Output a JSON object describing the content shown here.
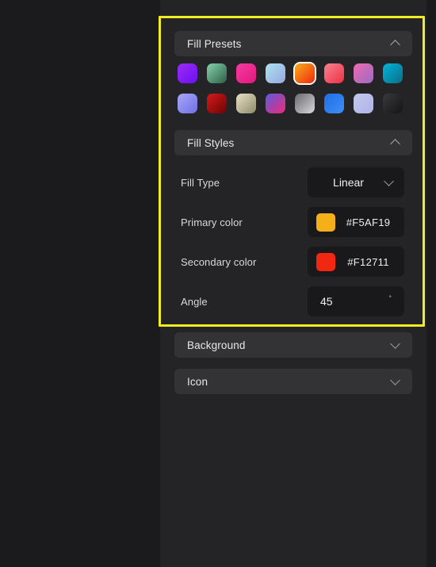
{
  "colors": {
    "canvas_bg": "#1b1b1d",
    "panel_bg": "#242426",
    "section_header_bg": "#333336",
    "field_bg": "#19191b",
    "highlight_border": "#f2ed21",
    "text_primary": "#e8e8ea",
    "text_secondary": "#d9d9dc"
  },
  "panel": {
    "sections": [
      {
        "id": "fill-presets",
        "label": "Fill Presets",
        "expanded": true,
        "chevron": "chevron-up-icon"
      },
      {
        "id": "fill-styles",
        "label": "Fill Styles",
        "expanded": true,
        "chevron": "chevron-up-icon"
      },
      {
        "id": "background",
        "label": "Background",
        "expanded": false,
        "chevron": "chevron-down-icon"
      },
      {
        "id": "icon",
        "label": "Icon",
        "expanded": false,
        "chevron": "chevron-down-icon"
      }
    ]
  },
  "fill_presets": {
    "selected_index": 4,
    "swatches": [
      {
        "name": "preset-violet",
        "gradient": "linear-gradient(135deg, #9d2bf5 0%, #6a11f0 100%)",
        "selected": false
      },
      {
        "name": "preset-green-mint",
        "gradient": "linear-gradient(135deg, #86d3ab 0%, #2c5f46 100%)",
        "selected": false
      },
      {
        "name": "preset-pink-magenta",
        "gradient": "linear-gradient(135deg, #f83a9e 0%, #e0197f 100%)",
        "selected": false
      },
      {
        "name": "preset-sky-lilac",
        "gradient": "linear-gradient(135deg, #a9e3f0 0%, #9aa7e0 100%)",
        "selected": false
      },
      {
        "name": "preset-orange-red",
        "gradient": "linear-gradient(135deg, #f5af19 0%, #f12711 100%)",
        "selected": true
      },
      {
        "name": "preset-coral-red",
        "gradient": "linear-gradient(135deg, #f7838e 0%, #ef3046 100%)",
        "selected": false
      },
      {
        "name": "preset-pink-purple",
        "gradient": "linear-gradient(135deg, #f06ab0 0%, #9b6bc4 100%)",
        "selected": false
      },
      {
        "name": "preset-cyan-teal",
        "gradient": "linear-gradient(135deg, #00b4d8 0%, #0b6e8a 100%)",
        "selected": false
      },
      {
        "name": "preset-periwinkle",
        "gradient": "linear-gradient(135deg, #a8a8f5 0%, #6f6fe8 100%)",
        "selected": false
      },
      {
        "name": "preset-crimson-dark",
        "gradient": "linear-gradient(135deg, #d61a1a 0%, #6b0404 100%)",
        "selected": false
      },
      {
        "name": "preset-sand-khaki",
        "gradient": "linear-gradient(135deg, #e8e2c4 0%, #8d8a6b 100%)",
        "selected": false
      },
      {
        "name": "preset-blue-pink",
        "gradient": "linear-gradient(135deg, #5b5bdc 0%, #f0297a 100%)",
        "selected": false
      },
      {
        "name": "preset-grey-silver",
        "gradient": "linear-gradient(135deg, #6a6a6e 0%, #d8d8dc 100%)",
        "selected": false
      },
      {
        "name": "preset-azure-blue",
        "gradient": "linear-gradient(135deg, #1e6ee8 0%, #3f8ef5 100%)",
        "selected": false
      },
      {
        "name": "preset-pale-lavender",
        "gradient": "linear-gradient(135deg, #c3c8ee 0%, #aeb5e6 100%)",
        "selected": false
      },
      {
        "name": "preset-charcoal",
        "gradient": "linear-gradient(135deg, #3a3a3c 0%, #141416 100%)",
        "selected": false
      }
    ]
  },
  "fill_styles": {
    "fill_type": {
      "label": "Fill Type",
      "value": "Linear",
      "chevron": "chevron-down-icon"
    },
    "primary_color": {
      "label": "Primary color",
      "hex": "#F5AF19",
      "swatch": "#F5AF19"
    },
    "secondary_color": {
      "label": "Secondary color",
      "hex": "#F12711",
      "swatch": "#F12711"
    },
    "angle": {
      "label": "Angle",
      "value": "45",
      "unit": "°"
    }
  }
}
